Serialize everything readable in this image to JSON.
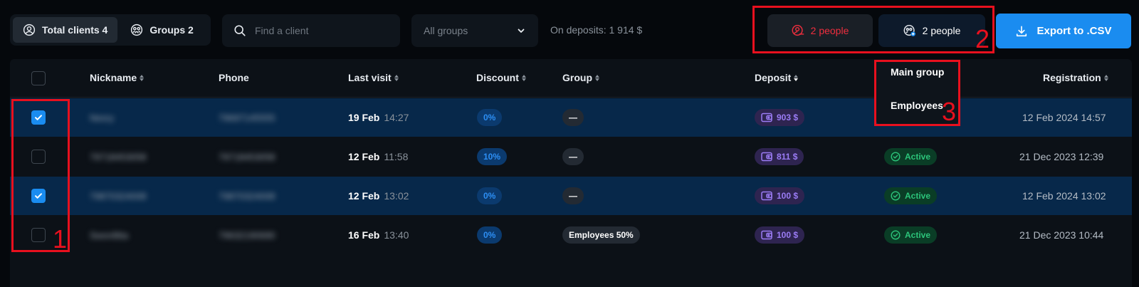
{
  "tabs": {
    "total_clients": "Total clients 4",
    "groups": "Groups 2"
  },
  "search": {
    "placeholder": "Find a client"
  },
  "group_filter": {
    "selected": "All groups"
  },
  "deposits_summary": "On deposits: 1 914 $",
  "people_red": "2 people",
  "people_blue": "2 people",
  "export_label": "Export to .CSV",
  "columns": {
    "nickname": "Nickname",
    "phone": "Phone",
    "last_visit": "Last visit",
    "discount": "Discount",
    "group": "Group",
    "deposit": "Deposit",
    "registration": "Registration"
  },
  "rows": [
    {
      "checked": true,
      "nickname": "Nesry",
      "phone": "79697145555",
      "visit_date": "19 Feb",
      "visit_time": "14:27",
      "discount": "0%",
      "group": "—",
      "deposit": "903 $",
      "status": "",
      "registration": "12 Feb 2024 14:57"
    },
    {
      "checked": false,
      "nickname": "79718453058",
      "phone": "79718453058",
      "visit_date": "12 Feb",
      "visit_time": "11:58",
      "discount": "10%",
      "group": "—",
      "deposit": "811 $",
      "status": "Active",
      "registration": "21 Dec 2023 12:39"
    },
    {
      "checked": true,
      "nickname": "79870324008",
      "phone": "79870324008",
      "visit_date": "12 Feb",
      "visit_time": "13:02",
      "discount": "0%",
      "group": "—",
      "deposit": "100 $",
      "status": "Active",
      "registration": "12 Feb 2024 13:02"
    },
    {
      "checked": false,
      "nickname": "Swon8tta",
      "phone": "79632190690",
      "visit_date": "16 Feb",
      "visit_time": "13:40",
      "discount": "0%",
      "group": "Employees 50%",
      "deposit": "100 $",
      "status": "Active",
      "registration": "21 Dec 2023 10:44"
    }
  ],
  "dropdown": {
    "items": [
      "Main group",
      "Employees"
    ]
  },
  "annotations": {
    "one": "1",
    "two": "2",
    "three": "3"
  },
  "colors": {
    "accent": "#1a8cf0",
    "danger": "#ef2e3e",
    "annotation": "#e8101e",
    "selected_row": "#07284a"
  }
}
